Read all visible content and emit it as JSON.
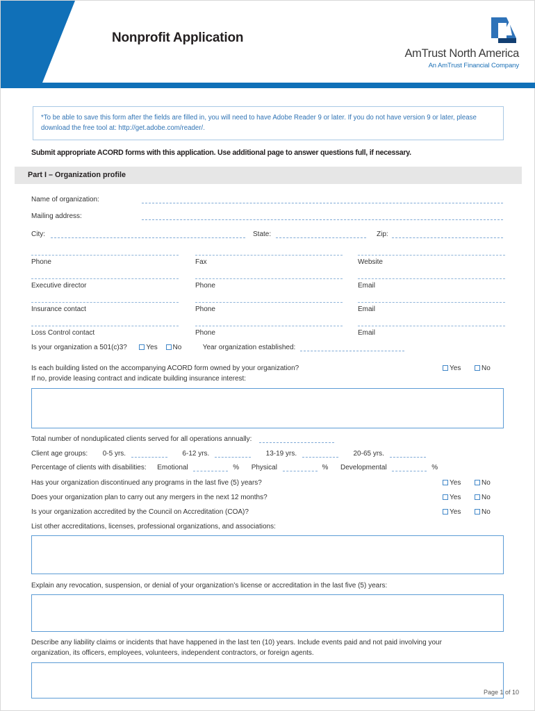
{
  "header": {
    "title": "Nonprofit Application",
    "logo_icon": "amtrust-a-logo-icon",
    "company_name": "AmTrust North America",
    "company_tagline": "An AmTrust Financial Company",
    "accent_color": "#1070b8",
    "logo_light_blue": "#2e72b8",
    "logo_dark_blue": "#123f72"
  },
  "notice": {
    "text": "*To be able to save this form after the fields are filled in, you will need to have Adobe Reader 9 or later. If you do not have version 9 or later, please download the free tool at: http://get.adobe.com/reader/.",
    "color": "#2f73b4"
  },
  "submit_instruction": "Submit appropriate ACORD forms with this application. Use additional page to answer questions full, if necessary.",
  "part": {
    "banner_label": "Part I – Organization profile"
  },
  "org_fields": [
    {
      "label": "Name of organization:"
    },
    {
      "label": "Mailing address:"
    }
  ],
  "city_row": {
    "city_label": "City:",
    "state_label": "State:",
    "zip_label": "Zip:"
  },
  "contact_grid": [
    {
      "c1": "Phone",
      "c2": "Fax",
      "c3": "Website"
    },
    {
      "c1": "Executive director",
      "c2": "Phone",
      "c3": "Email"
    },
    {
      "c1": "Insurance contact",
      "c2": "Phone",
      "c3": "Email"
    },
    {
      "c1": "Loss Control contact",
      "c2": "Phone",
      "c3": "Email"
    }
  ],
  "q501c3": {
    "question": "Is your organization a 501(c)3?",
    "yes": "Yes",
    "no": "No",
    "year_label": "Year organization established:"
  },
  "building_q": {
    "line1": "Is each building listed on the accompanying ACORD form owned by your organization?",
    "line2": "If no, provide leasing contract and indicate building insurance interest:",
    "yes": "Yes",
    "no": "No"
  },
  "clients": {
    "total_label": "Total number of nonduplicated clients served for all operations annually:",
    "age_label": "Client age groups:",
    "age_groups": [
      "0-5 yrs.",
      "6-12 yrs.",
      "13-19 yrs.",
      "20-65 yrs."
    ],
    "disability_label": "Percentage of clients with disabilities:",
    "disability_types": [
      "Emotional",
      "Physical",
      "Developmental"
    ],
    "percent_sign": "%"
  },
  "yes_no_questions": [
    {
      "question": "Has your organization discontinued any programs in the last five (5) years?",
      "yes": "Yes",
      "no": "No"
    },
    {
      "question": "Does your organization plan to carry out any mergers in the next 12 months?",
      "yes": "Yes",
      "no": "No"
    },
    {
      "question": "Is your organization accredited by the Council on Accreditation (COA)?",
      "yes": "Yes",
      "no": "No"
    }
  ],
  "accreditations": {
    "prompt": "List other accreditations, licenses, professional organizations, and associations:",
    "value": ""
  },
  "revocation": {
    "prompt": "Explain any revocation, suspension, or denial of your organization’s license or accreditation in the last five (5) years:",
    "value": ""
  },
  "liability": {
    "prompt_line1": "Describe any liability claims or incidents that have happened in the last ten (10) years. Include events paid and not paid involving your",
    "prompt_line2": "organization, its officers, employees, volunteers, independent contractors, or foreign agents.",
    "value": ""
  },
  "building_textbox": {
    "value": ""
  },
  "footer": {
    "page_label": "Page 1 of 10"
  }
}
